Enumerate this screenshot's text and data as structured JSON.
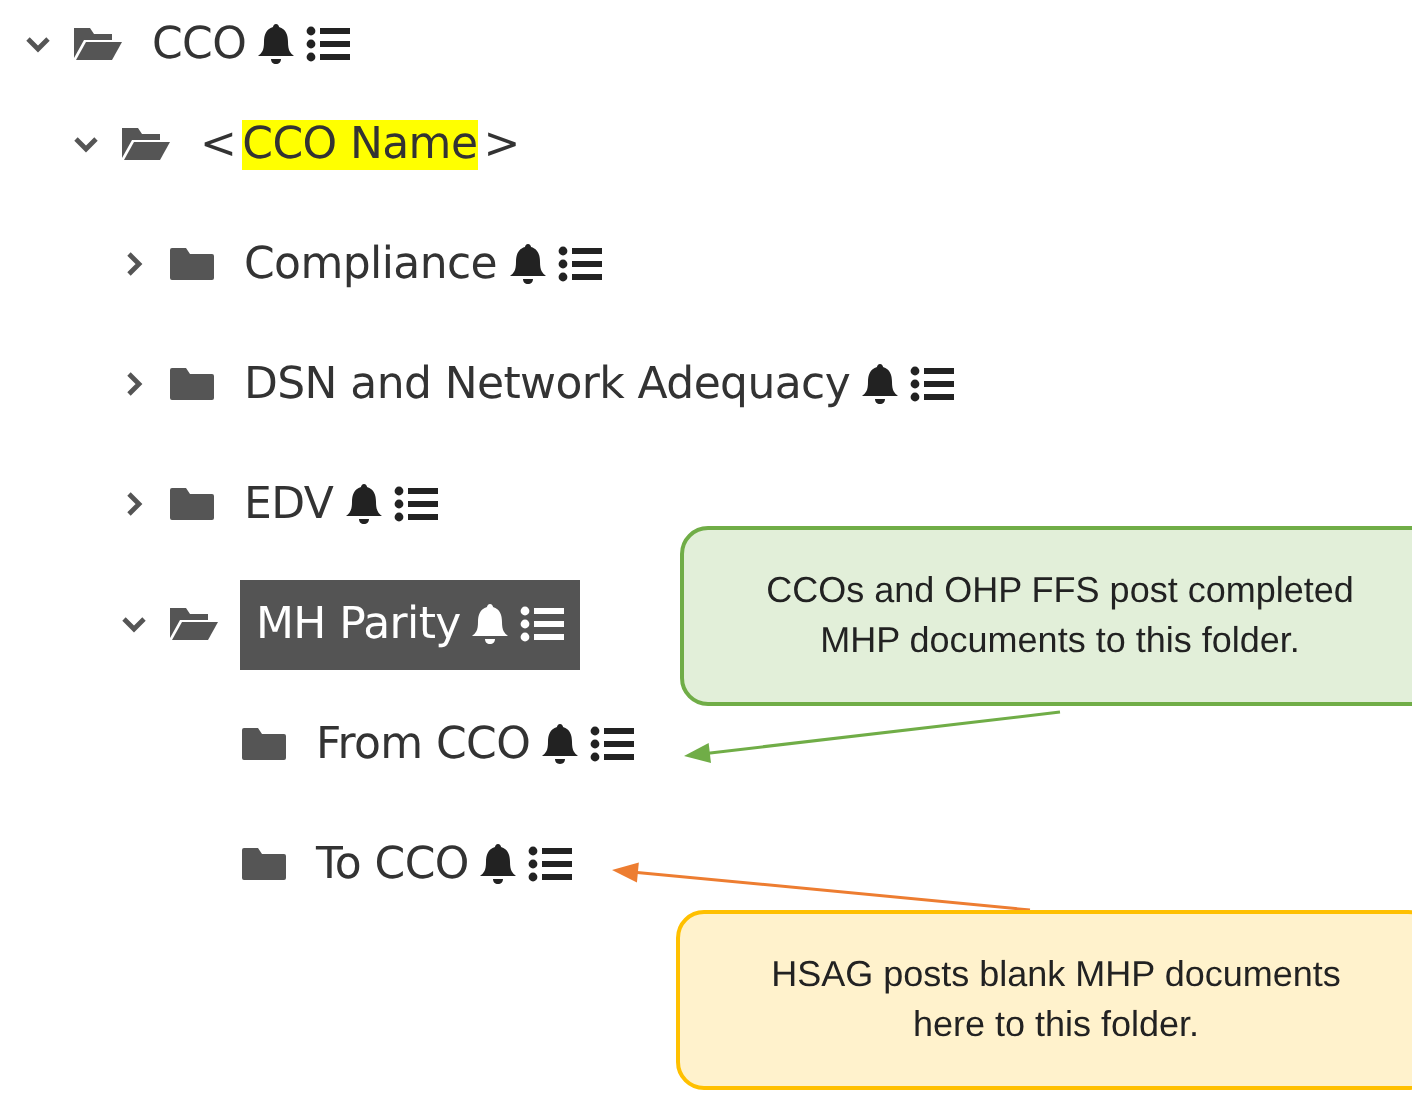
{
  "tree": [
    {
      "label": "CCO",
      "expanded": true,
      "selected": false,
      "icons": true,
      "children": [
        {
          "label_prefix": "<",
          "label_highlight": "CCO Name",
          "label_suffix": ">",
          "expanded": true,
          "selected": false,
          "icons": false,
          "children": [
            {
              "label": "Compliance",
              "expanded": false,
              "selected": false,
              "icons": true
            },
            {
              "label": "DSN and Network Adequacy",
              "expanded": false,
              "selected": false,
              "icons": true
            },
            {
              "label": "EDV",
              "expanded": false,
              "selected": false,
              "icons": true
            },
            {
              "label": "MH Parity",
              "expanded": true,
              "selected": true,
              "icons": true,
              "children": [
                {
                  "label": "From CCO",
                  "selected": false,
                  "icons": true
                },
                {
                  "label": "To CCO",
                  "selected": false,
                  "icons": true
                }
              ]
            }
          ]
        }
      ]
    }
  ],
  "callouts": [
    {
      "kind": "green",
      "text": "CCOs and OHP FFS post completed MHP documents to this folder."
    },
    {
      "kind": "yellow",
      "text": "HSAG posts blank MHP documents here to this folder."
    }
  ]
}
